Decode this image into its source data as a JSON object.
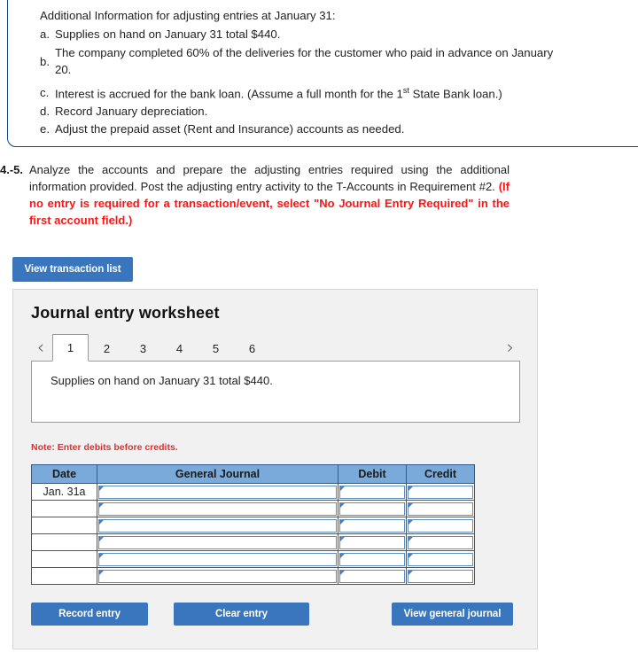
{
  "info_box": {
    "title": "Additional Information for adjusting entries at January 31:",
    "items": [
      {
        "key": "a.",
        "text": "Supplies on hand on January 31 total $440."
      },
      {
        "key": "b.",
        "text": "The company completed 60% of the deliveries for the customer who paid in advance on January 20."
      },
      {
        "key": "c.",
        "text_before": "Interest is accrued for the bank loan. (Assume a full month for the 1",
        "sup": "st",
        "text_after": " State Bank loan.)"
      },
      {
        "key": "d.",
        "text": "Record January depreciation."
      },
      {
        "key": "e.",
        "text": "Adjust the prepaid asset (Rent and Insurance) accounts as needed."
      }
    ]
  },
  "requirement": {
    "number": "4.-5.",
    "body": "Analyze the accounts and prepare the adjusting entries required using the additional information provided. Post the adjusting entry activity to the T-Accounts in Requirement #2. ",
    "red_note": "(If no entry is required for a transaction/event, select \"No Journal Entry Required\" in the first account field.)"
  },
  "buttons": {
    "view_transaction_list": "View transaction list",
    "record_entry": "Record entry",
    "clear_entry": "Clear entry",
    "view_general_journal": "View general journal"
  },
  "worksheet": {
    "title": "Journal entry worksheet",
    "prev_arrow": "‹",
    "next_arrow": "›",
    "tabs": [
      {
        "label": "1",
        "active": true
      },
      {
        "label": "2",
        "active": false
      },
      {
        "label": "3",
        "active": false
      },
      {
        "label": "4",
        "active": false
      },
      {
        "label": "5",
        "active": false
      },
      {
        "label": "6",
        "active": false
      }
    ],
    "tab_content": "Supplies on hand on January 31 total $440.",
    "note": "Note: Enter debits before credits.",
    "table": {
      "headers": [
        "Date",
        "General Journal",
        "Debit",
        "Credit"
      ],
      "rows": [
        {
          "date": "Jan. 31a",
          "general_journal": "",
          "debit": "",
          "credit": ""
        },
        {
          "date": "",
          "general_journal": "",
          "debit": "",
          "credit": ""
        },
        {
          "date": "",
          "general_journal": "",
          "debit": "",
          "credit": ""
        },
        {
          "date": "",
          "general_journal": "",
          "debit": "",
          "credit": ""
        },
        {
          "date": "",
          "general_journal": "",
          "debit": "",
          "credit": ""
        },
        {
          "date": "",
          "general_journal": "",
          "debit": "",
          "credit": ""
        }
      ]
    }
  },
  "colors": {
    "accent_blue": "#3a76bd",
    "header_blue": "#7aaada",
    "red": "#ff1414",
    "note_red": "#e03030",
    "box_border": "#14477d"
  }
}
